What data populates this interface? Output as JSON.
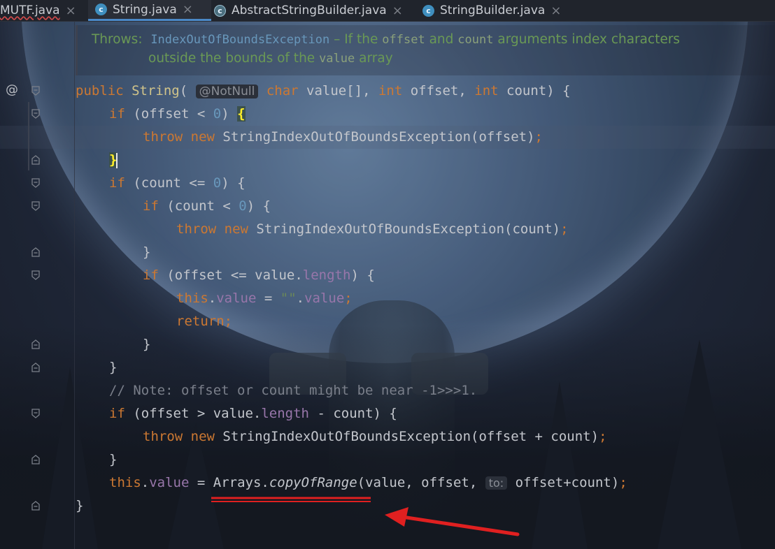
{
  "tabs": [
    {
      "label": "MUTF.java",
      "icon": "none",
      "active": false
    },
    {
      "label": "String.java",
      "icon": "class-icon",
      "active": true
    },
    {
      "label": "AbstractStringBuilder.java",
      "icon": "abstract-class-icon",
      "active": false
    },
    {
      "label": "StringBuilder.java",
      "icon": "class-icon",
      "active": false
    }
  ],
  "close_glyph": "×",
  "class_glyph": "c",
  "gutter": {
    "override_marker": "@"
  },
  "doc": {
    "throws_label": "Throws:",
    "exception": "IndexOutOfBoundsException",
    "dash_text": " – If the ",
    "offset": "offset",
    "and_text": " and ",
    "count": "count",
    "arguments_text": " arguments index characters",
    "line2_prefix": "outside the bounds of the ",
    "value": "value",
    "line2_suffix": " array"
  },
  "code": {
    "public": "public",
    "String": "String",
    "open_paren": "( ",
    "notnull": "@NotNull",
    "char": "char",
    "value_arr": " value[], ",
    "int": "int",
    "offset_param": " offset, ",
    "count_param": " count) {",
    "if": "if",
    "cond_offset_lt0": " (offset < ",
    "zero": "0",
    "close_paren_space": ") ",
    "open_brace": "{",
    "close_brace": "}",
    "throw": "throw",
    "new": "new",
    "exc_class": " StringIndexOutOfBoundsException",
    "arg_offset": "(offset)",
    "arg_count": "(count)",
    "arg_offset_count": "(offset + count)",
    "semicolon": ";",
    "cond_count_le0": " (count <= ",
    "cond_count_lt0": " (count < ",
    "paren_brace": ") {",
    "cond_offset_le_len_a": " (offset <= value.",
    "length": "length",
    "this": "this",
    "dot": ".",
    "value_field": "value",
    "assign": " = ",
    "empty_str": "\"\"",
    "return": "return",
    "comment": "// Note: offset or count might be near -1>>>1.",
    "cond_offset_gt_a": " (offset > value.",
    "minus_count": " - count) {",
    "arrays": "Arrays.",
    "copy_of_range": "copyOfRange",
    "call_args_a": "(value, offset, ",
    "to_hint": "to:",
    "call_args_b": " offset+count)",
    "comma": ","
  },
  "colors": {
    "keyword": "#cc7832",
    "field": "#9876aa",
    "number": "#6897bb",
    "comment": "#7a7f8a",
    "doc": "#6a9955",
    "annotation_red": "#e02020"
  }
}
